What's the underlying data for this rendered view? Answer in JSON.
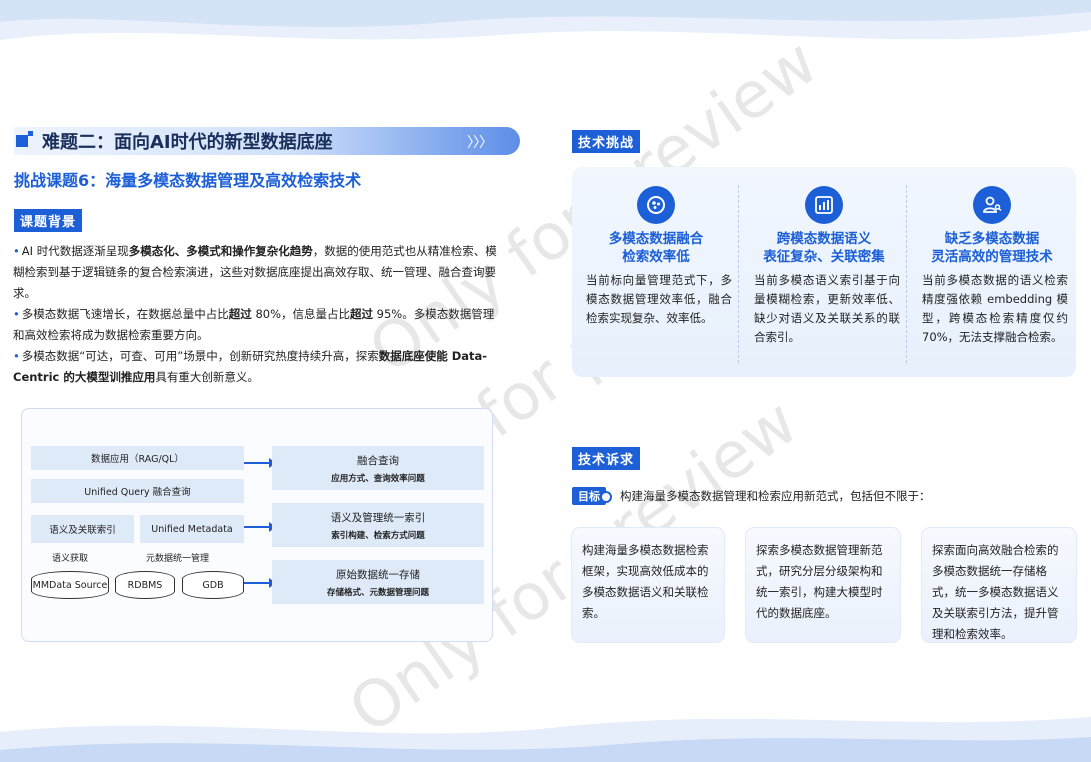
{
  "header": {
    "title": "难题二：面向AI时代的新型数据底座",
    "arrows": "〉〉〉",
    "subtitle": "挑战课题6：海量多模态数据管理及高效检索技术"
  },
  "watermark": "Only for preview",
  "background": {
    "tag": "课题背景",
    "bullets": [
      {
        "parts": [
          {
            "t": "AI 时代数据逐渐呈现"
          },
          {
            "t": "多模态化、多模式和操作复杂化趋势",
            "b": true
          },
          {
            "t": "，数据的使用范式也从精准检索、模糊检索到基于逻辑链条的复合检索演进，这些对数据底座提出高效存取、统一管理、融合查询要求。"
          }
        ]
      },
      {
        "parts": [
          {
            "t": "多模态数据飞速增长，在数据总量中占比"
          },
          {
            "t": "超过",
            "b": true
          },
          {
            "t": " 80%，信息量占比"
          },
          {
            "t": "超过",
            "b": true
          },
          {
            "t": " 95%。多模态数据管理和高效检索将成为数据检索重要方向。"
          }
        ]
      },
      {
        "parts": [
          {
            "t": "多模态数据“可达，可查、可用”场景中，创新研究热度持续升高，探索"
          },
          {
            "t": "数据底座使能 Data-Centric 的大模型训推应用",
            "b": true
          },
          {
            "t": "具有重大创新意义。"
          }
        ]
      }
    ]
  },
  "diagram": {
    "data_app": "数据应用（RAG/QL）",
    "unified_query": "Unified Query 融合查询",
    "semantic_index": "语义及关联索引",
    "unified_metadata": "Unified Metadata",
    "semantic_fetch": "语义获取",
    "meta_manage": "元数据统一管理",
    "stores": [
      "MMData Source",
      "RDBMS",
      "GDB"
    ],
    "right_boxes": [
      {
        "title": "融合查询",
        "sub": "应用方式、查询效率问题"
      },
      {
        "title": "语义及管理统一索引",
        "sub": "索引构建、检索方式问题"
      },
      {
        "title": "原始数据统一存储",
        "sub": "存储格式、元数据管理问题"
      }
    ]
  },
  "challenges": {
    "tag": "技术挑战",
    "items": [
      {
        "icon": "fusion-icon",
        "title1": "多模态数据融合",
        "title2": "检索效率低",
        "body": "当前标向量管理范式下，多模态数据管理效率低，融合检索实现复杂、效率低。"
      },
      {
        "icon": "bar-chart-icon",
        "title1": "跨模态数据语义",
        "title2": "表征复杂、关联密集",
        "body": "当前多模态语义索引基于向量模糊检索，更新效率低、缺少对语义及关联关系的联合索引。"
      },
      {
        "icon": "user-search-icon",
        "title1": "缺乏多模态数据",
        "title2": "灵活高效的管理技术",
        "body": "当前多模态数据的语义检索精度强依赖 embedding 模型，跨模态检索精度仅约 70%，无法支撑融合检索。"
      }
    ]
  },
  "demands": {
    "tag": "技术诉求",
    "goal_badge": "目标",
    "goal_text": "构建海量多模态数据管理和检索应用新范式，包括但不限于：",
    "cards": [
      "构建海量多模态数据检索框架，实现高效低成本的多模态数据语义和关联检索。",
      "探索多模态数据管理新范式，研究分层分级架构和统一索引，构建大模型时代的数据底座。",
      "探索面向高效融合检索的多模态数据统一存储格式，统一多模态数据语义及关联索引方法，提升管理和检索效率。"
    ]
  },
  "colors": {
    "primary": "#1c5fd6",
    "panel": "#eef4fd"
  }
}
